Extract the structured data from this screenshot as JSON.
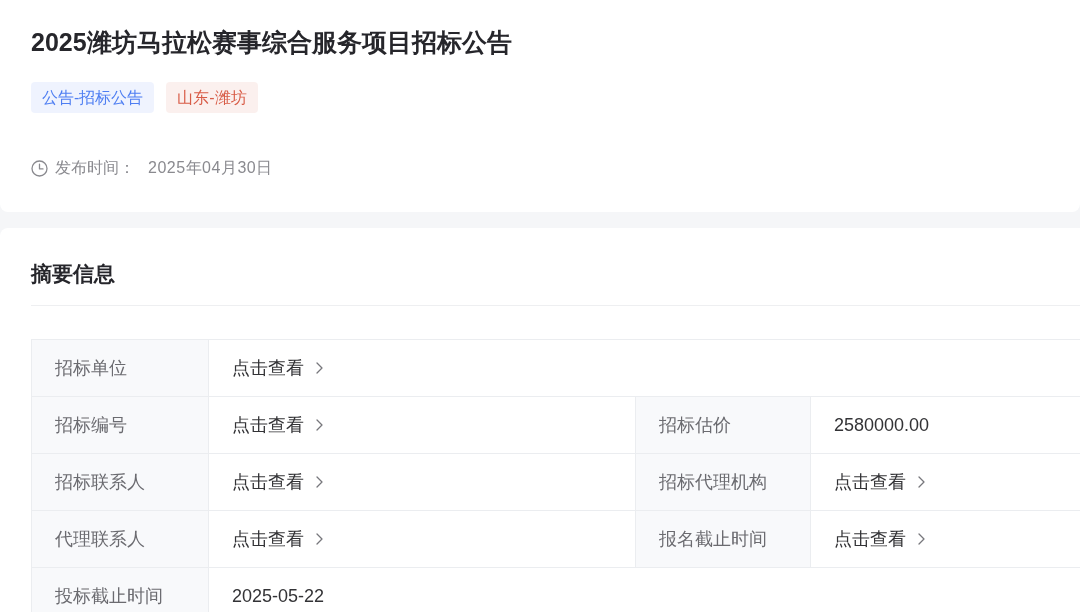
{
  "title": "2025潍坊马拉松赛事综合服务项目招标公告",
  "tags": [
    {
      "label": "公告-招标公告",
      "color": "#4e7ef2"
    },
    {
      "label": "山东-潍坊",
      "color": "#d85c47"
    }
  ],
  "publish": {
    "label": "发布时间：",
    "value": "2025年04月30日"
  },
  "summary": {
    "heading": "摘要信息",
    "rows": [
      {
        "fields": [
          {
            "label": "招标单位",
            "value": "点击查看",
            "kind": "link"
          }
        ]
      },
      {
        "fields": [
          {
            "label": "招标编号",
            "value": "点击查看",
            "kind": "link"
          },
          {
            "label": "招标估价",
            "value": "2580000.00",
            "kind": "text"
          }
        ]
      },
      {
        "fields": [
          {
            "label": "招标联系人",
            "value": "点击查看",
            "kind": "link"
          },
          {
            "label": "招标代理机构",
            "value": "点击查看",
            "kind": "link"
          }
        ]
      },
      {
        "fields": [
          {
            "label": "代理联系人",
            "value": "点击查看",
            "kind": "link"
          },
          {
            "label": "报名截止时间",
            "value": "点击查看",
            "kind": "link"
          }
        ]
      },
      {
        "fields": [
          {
            "label": "投标截止时间",
            "value": "2025-05-22",
            "kind": "text"
          }
        ]
      }
    ]
  }
}
